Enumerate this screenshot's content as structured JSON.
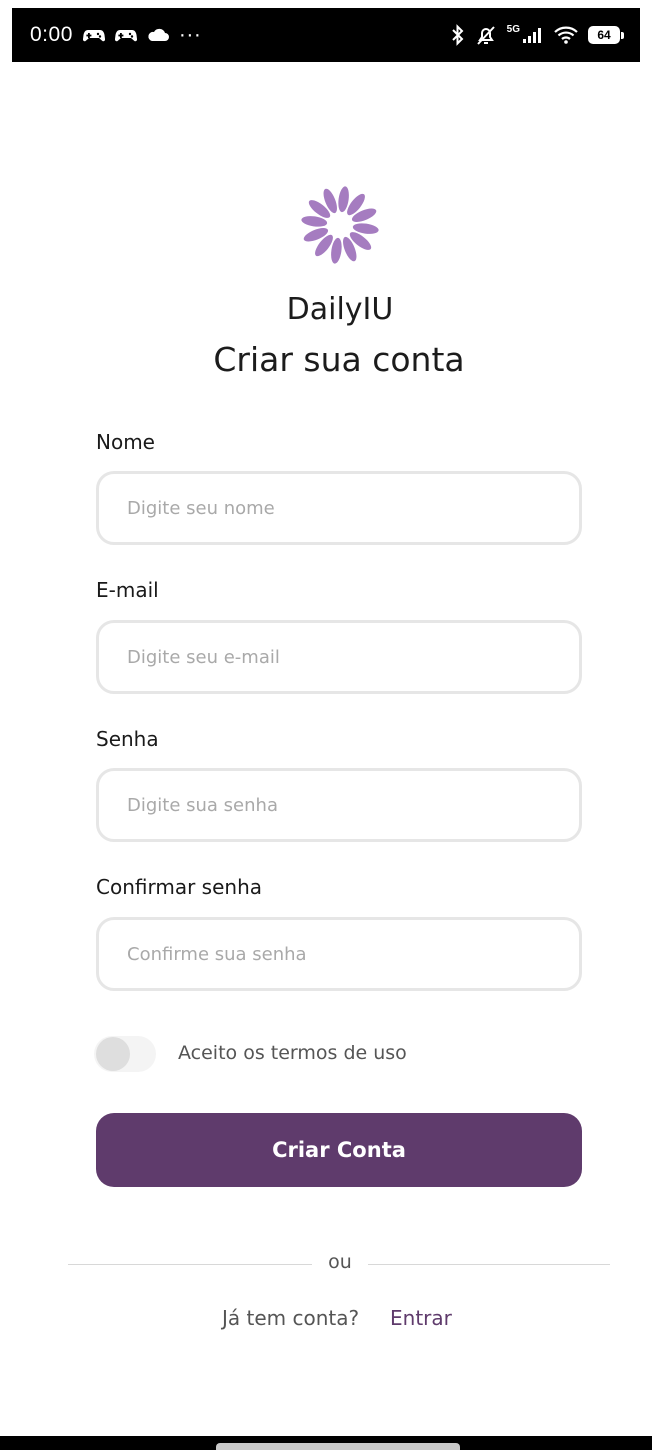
{
  "status_bar": {
    "time": "0:00",
    "more_indicator": "···",
    "network_label": "5G",
    "battery_level": "64",
    "icons": [
      "game-controller-icon",
      "game-controller-icon",
      "cloud-icon",
      "bluetooth-icon",
      "bell-muted-icon",
      "signal-bars-icon",
      "wifi-icon",
      "battery-icon"
    ]
  },
  "app": {
    "logo_icon": "flower-logo-icon",
    "logo_color": "#a57cc0",
    "name": "DailyIU"
  },
  "page": {
    "title": "Criar sua conta"
  },
  "form": {
    "name": {
      "label": "Nome",
      "value": "",
      "placeholder": "Digite seu nome"
    },
    "email": {
      "label": "E-mail",
      "value": "",
      "placeholder": "Digite seu e-mail"
    },
    "password": {
      "label": "Senha",
      "value": "",
      "placeholder": "Digite sua senha"
    },
    "confirm_password": {
      "label": "Confirmar senha",
      "value": "",
      "placeholder": "Confirme sua senha"
    },
    "terms": {
      "label": "Aceito os termos de uso",
      "checked": false
    },
    "submit_label": "Criar Conta"
  },
  "divider": {
    "text": "ou"
  },
  "login": {
    "prompt": "Já tem conta?",
    "link_label": "Entrar"
  },
  "colors": {
    "primary": "#5f3b6c",
    "input_border": "#e6e6e6",
    "placeholder": "#a9a9a9"
  }
}
